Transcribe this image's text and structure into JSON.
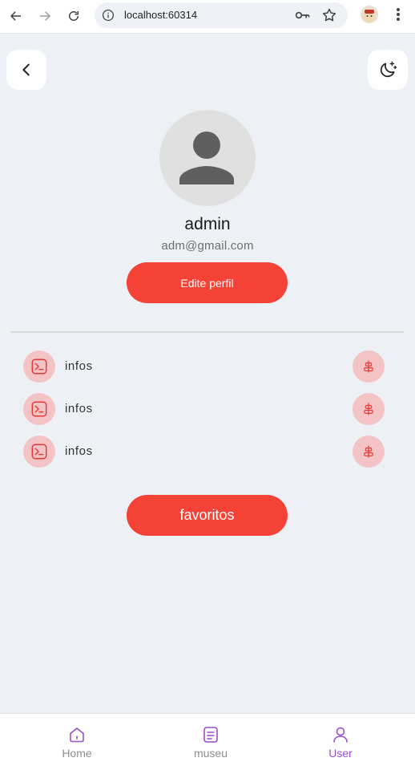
{
  "browser": {
    "url": "localhost:60314"
  },
  "profile": {
    "username": "admin",
    "email": "adm@gmail.com",
    "edit_label": "Edite perfil"
  },
  "info_rows": [
    {
      "label": "infos"
    },
    {
      "label": "infos"
    },
    {
      "label": "infos"
    }
  ],
  "favorites_label": "favoritos",
  "bottom_nav": {
    "items": [
      {
        "label": "Home",
        "icon": "home-icon",
        "active": false
      },
      {
        "label": "museu",
        "icon": "document-icon",
        "active": false
      },
      {
        "label": "User",
        "icon": "user-icon",
        "active": true
      }
    ]
  },
  "colors": {
    "primary_red": "#f44336",
    "accent_purple": "#9c4dcc",
    "background": "#edf0f5",
    "soft_red": "#f4c3c6"
  }
}
